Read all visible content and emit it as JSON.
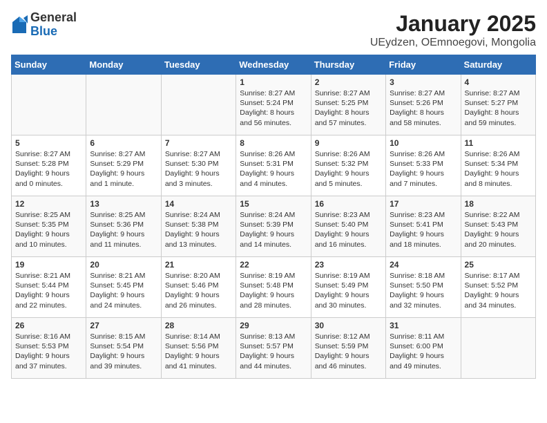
{
  "header": {
    "logo_general": "General",
    "logo_blue": "Blue",
    "title": "January 2025",
    "subtitle": "UEydzen, OEmnoegovi, Mongolia"
  },
  "weekdays": [
    "Sunday",
    "Monday",
    "Tuesday",
    "Wednesday",
    "Thursday",
    "Friday",
    "Saturday"
  ],
  "weeks": [
    [
      {
        "day": "",
        "sunrise": "",
        "sunset": "",
        "daylight": ""
      },
      {
        "day": "",
        "sunrise": "",
        "sunset": "",
        "daylight": ""
      },
      {
        "day": "",
        "sunrise": "",
        "sunset": "",
        "daylight": ""
      },
      {
        "day": "1",
        "sunrise": "Sunrise: 8:27 AM",
        "sunset": "Sunset: 5:24 PM",
        "daylight": "Daylight: 8 hours and 56 minutes."
      },
      {
        "day": "2",
        "sunrise": "Sunrise: 8:27 AM",
        "sunset": "Sunset: 5:25 PM",
        "daylight": "Daylight: 8 hours and 57 minutes."
      },
      {
        "day": "3",
        "sunrise": "Sunrise: 8:27 AM",
        "sunset": "Sunset: 5:26 PM",
        "daylight": "Daylight: 8 hours and 58 minutes."
      },
      {
        "day": "4",
        "sunrise": "Sunrise: 8:27 AM",
        "sunset": "Sunset: 5:27 PM",
        "daylight": "Daylight: 8 hours and 59 minutes."
      }
    ],
    [
      {
        "day": "5",
        "sunrise": "Sunrise: 8:27 AM",
        "sunset": "Sunset: 5:28 PM",
        "daylight": "Daylight: 9 hours and 0 minutes."
      },
      {
        "day": "6",
        "sunrise": "Sunrise: 8:27 AM",
        "sunset": "Sunset: 5:29 PM",
        "daylight": "Daylight: 9 hours and 1 minute."
      },
      {
        "day": "7",
        "sunrise": "Sunrise: 8:27 AM",
        "sunset": "Sunset: 5:30 PM",
        "daylight": "Daylight: 9 hours and 3 minutes."
      },
      {
        "day": "8",
        "sunrise": "Sunrise: 8:26 AM",
        "sunset": "Sunset: 5:31 PM",
        "daylight": "Daylight: 9 hours and 4 minutes."
      },
      {
        "day": "9",
        "sunrise": "Sunrise: 8:26 AM",
        "sunset": "Sunset: 5:32 PM",
        "daylight": "Daylight: 9 hours and 5 minutes."
      },
      {
        "day": "10",
        "sunrise": "Sunrise: 8:26 AM",
        "sunset": "Sunset: 5:33 PM",
        "daylight": "Daylight: 9 hours and 7 minutes."
      },
      {
        "day": "11",
        "sunrise": "Sunrise: 8:26 AM",
        "sunset": "Sunset: 5:34 PM",
        "daylight": "Daylight: 9 hours and 8 minutes."
      }
    ],
    [
      {
        "day": "12",
        "sunrise": "Sunrise: 8:25 AM",
        "sunset": "Sunset: 5:35 PM",
        "daylight": "Daylight: 9 hours and 10 minutes."
      },
      {
        "day": "13",
        "sunrise": "Sunrise: 8:25 AM",
        "sunset": "Sunset: 5:36 PM",
        "daylight": "Daylight: 9 hours and 11 minutes."
      },
      {
        "day": "14",
        "sunrise": "Sunrise: 8:24 AM",
        "sunset": "Sunset: 5:38 PM",
        "daylight": "Daylight: 9 hours and 13 minutes."
      },
      {
        "day": "15",
        "sunrise": "Sunrise: 8:24 AM",
        "sunset": "Sunset: 5:39 PM",
        "daylight": "Daylight: 9 hours and 14 minutes."
      },
      {
        "day": "16",
        "sunrise": "Sunrise: 8:23 AM",
        "sunset": "Sunset: 5:40 PM",
        "daylight": "Daylight: 9 hours and 16 minutes."
      },
      {
        "day": "17",
        "sunrise": "Sunrise: 8:23 AM",
        "sunset": "Sunset: 5:41 PM",
        "daylight": "Daylight: 9 hours and 18 minutes."
      },
      {
        "day": "18",
        "sunrise": "Sunrise: 8:22 AM",
        "sunset": "Sunset: 5:43 PM",
        "daylight": "Daylight: 9 hours and 20 minutes."
      }
    ],
    [
      {
        "day": "19",
        "sunrise": "Sunrise: 8:21 AM",
        "sunset": "Sunset: 5:44 PM",
        "daylight": "Daylight: 9 hours and 22 minutes."
      },
      {
        "day": "20",
        "sunrise": "Sunrise: 8:21 AM",
        "sunset": "Sunset: 5:45 PM",
        "daylight": "Daylight: 9 hours and 24 minutes."
      },
      {
        "day": "21",
        "sunrise": "Sunrise: 8:20 AM",
        "sunset": "Sunset: 5:46 PM",
        "daylight": "Daylight: 9 hours and 26 minutes."
      },
      {
        "day": "22",
        "sunrise": "Sunrise: 8:19 AM",
        "sunset": "Sunset: 5:48 PM",
        "daylight": "Daylight: 9 hours and 28 minutes."
      },
      {
        "day": "23",
        "sunrise": "Sunrise: 8:19 AM",
        "sunset": "Sunset: 5:49 PM",
        "daylight": "Daylight: 9 hours and 30 minutes."
      },
      {
        "day": "24",
        "sunrise": "Sunrise: 8:18 AM",
        "sunset": "Sunset: 5:50 PM",
        "daylight": "Daylight: 9 hours and 32 minutes."
      },
      {
        "day": "25",
        "sunrise": "Sunrise: 8:17 AM",
        "sunset": "Sunset: 5:52 PM",
        "daylight": "Daylight: 9 hours and 34 minutes."
      }
    ],
    [
      {
        "day": "26",
        "sunrise": "Sunrise: 8:16 AM",
        "sunset": "Sunset: 5:53 PM",
        "daylight": "Daylight: 9 hours and 37 minutes."
      },
      {
        "day": "27",
        "sunrise": "Sunrise: 8:15 AM",
        "sunset": "Sunset: 5:54 PM",
        "daylight": "Daylight: 9 hours and 39 minutes."
      },
      {
        "day": "28",
        "sunrise": "Sunrise: 8:14 AM",
        "sunset": "Sunset: 5:56 PM",
        "daylight": "Daylight: 9 hours and 41 minutes."
      },
      {
        "day": "29",
        "sunrise": "Sunrise: 8:13 AM",
        "sunset": "Sunset: 5:57 PM",
        "daylight": "Daylight: 9 hours and 44 minutes."
      },
      {
        "day": "30",
        "sunrise": "Sunrise: 8:12 AM",
        "sunset": "Sunset: 5:59 PM",
        "daylight": "Daylight: 9 hours and 46 minutes."
      },
      {
        "day": "31",
        "sunrise": "Sunrise: 8:11 AM",
        "sunset": "Sunset: 6:00 PM",
        "daylight": "Daylight: 9 hours and 49 minutes."
      },
      {
        "day": "",
        "sunrise": "",
        "sunset": "",
        "daylight": ""
      }
    ]
  ]
}
